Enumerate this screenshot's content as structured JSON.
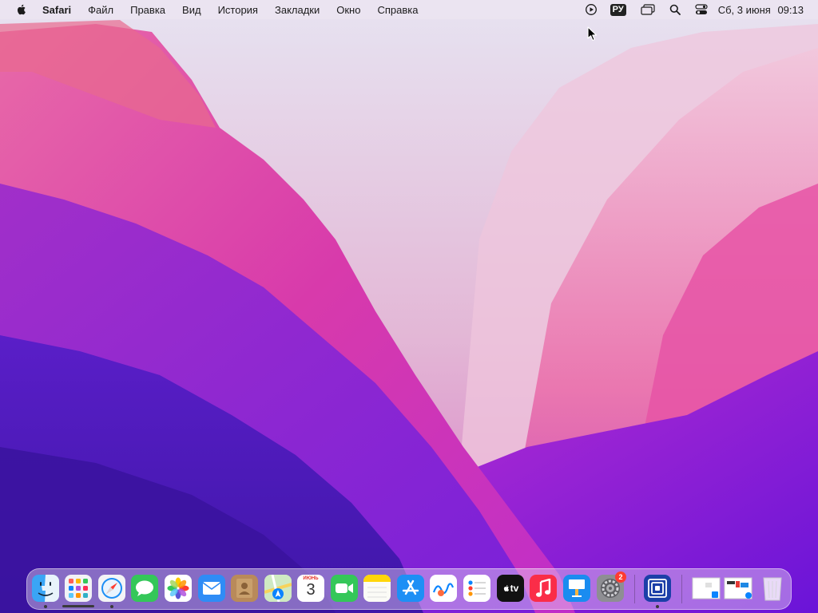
{
  "menubar": {
    "app_name": "Safari",
    "items": [
      "Файл",
      "Правка",
      "Вид",
      "История",
      "Закладки",
      "Окно",
      "Справка"
    ],
    "status": {
      "input_source": "РУ",
      "date": "Сб, 3 июня",
      "time": "09:13"
    }
  },
  "dock": {
    "apps": [
      {
        "name": "Finder",
        "icon": "finder-icon",
        "running": true
      },
      {
        "name": "Launchpad",
        "icon": "launchpad-icon",
        "running": false
      },
      {
        "name": "Safari",
        "icon": "safari-icon",
        "running": true
      },
      {
        "name": "Messages",
        "icon": "messages-icon",
        "running": false
      },
      {
        "name": "Photos",
        "icon": "photos-icon",
        "running": false
      },
      {
        "name": "Mail",
        "icon": "mail-icon",
        "running": false
      },
      {
        "name": "Contacts",
        "icon": "contacts-icon",
        "running": false
      },
      {
        "name": "Maps",
        "icon": "maps-icon",
        "running": false
      },
      {
        "name": "Calendar",
        "icon": "calendar-icon",
        "running": false
      },
      {
        "name": "FaceTime",
        "icon": "facetime-icon",
        "running": false
      },
      {
        "name": "Notes",
        "icon": "notes-icon",
        "running": false
      },
      {
        "name": "App Store",
        "icon": "app-store-icon",
        "running": false
      },
      {
        "name": "Freeform",
        "icon": "freeform-icon",
        "running": false
      },
      {
        "name": "Reminders",
        "icon": "reminders-icon",
        "running": false
      },
      {
        "name": "TV",
        "icon": "tv-icon",
        "running": false
      },
      {
        "name": "Music",
        "icon": "music-icon",
        "running": false
      },
      {
        "name": "Keynote",
        "icon": "keynote-icon",
        "running": false
      },
      {
        "name": "System Settings",
        "icon": "gear-icon",
        "running": false
      }
    ],
    "calendar": {
      "month": "ИЮНЬ",
      "day": "3"
    },
    "tv_label": "tv",
    "settings_badge": "2",
    "extra_app": {
      "name": "Window Manager",
      "icon": "window-manager-icon",
      "running": true
    },
    "recents": [
      "document-thumbnail-1",
      "document-thumbnail-2"
    ],
    "trash": "trash-icon"
  },
  "colors": {
    "accent": "#0a84ff",
    "wallpaper_light": "#e8e4f0",
    "wallpaper_pink": "#e0449e",
    "wallpaper_violet": "#6a1ad0",
    "badge_red": "#ff3b30"
  }
}
